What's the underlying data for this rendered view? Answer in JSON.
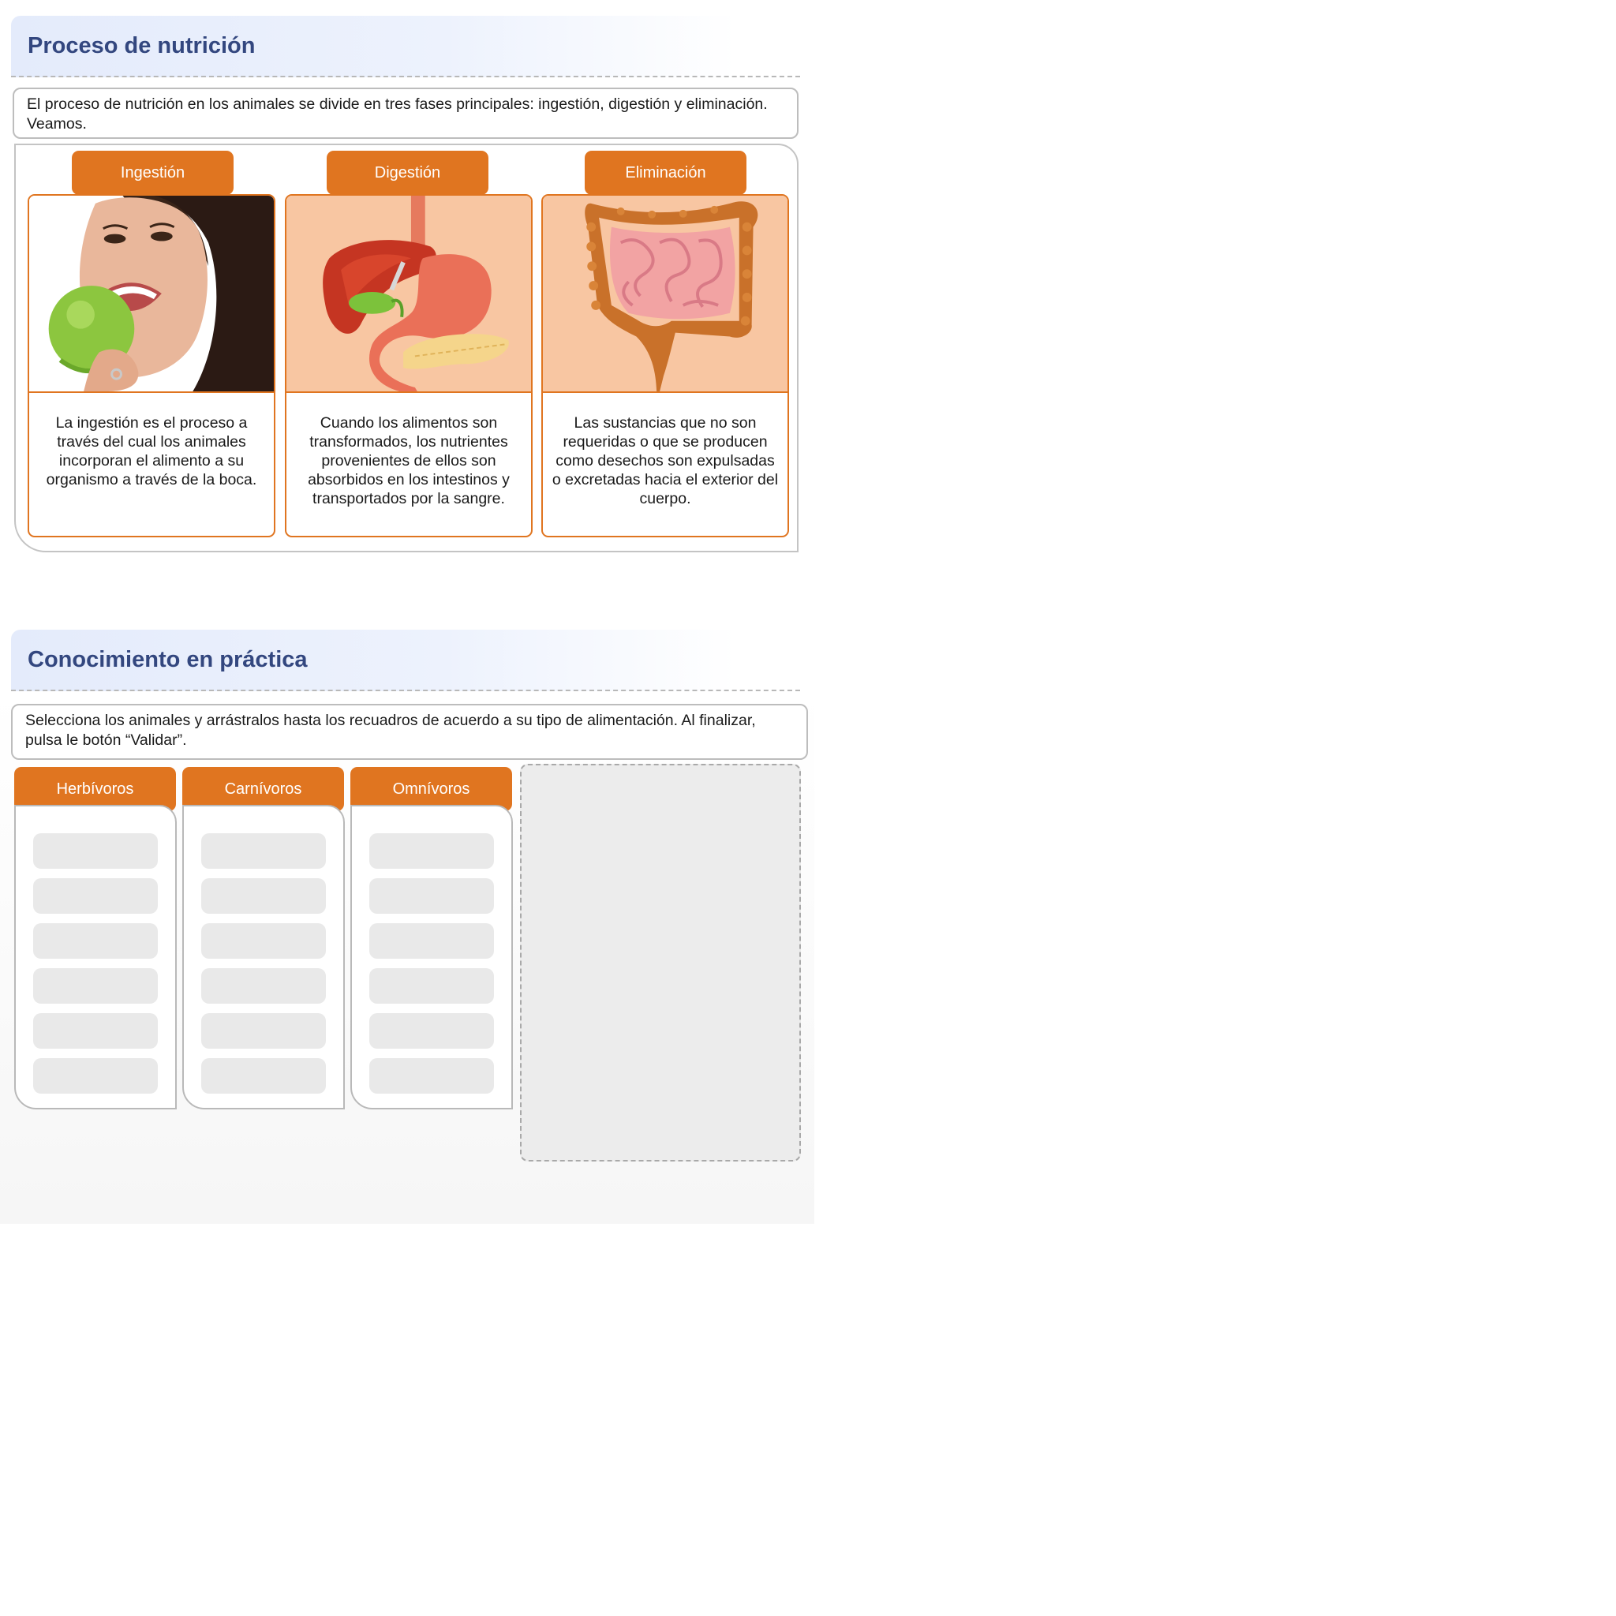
{
  "section1": {
    "title": "Proceso de nutrición",
    "intro": "El proceso de nutrición en los animales se divide en tres fases principales: ingestión, digestión y eliminación. Veamos.",
    "phases": [
      {
        "tab": "Ingestión",
        "image_icon": "person-eating-apple-image",
        "text": "La ingestión es el proceso a través del cual los animales incorporan el alimento a su organismo a través de la boca."
      },
      {
        "tab": "Digestión",
        "image_icon": "digestive-organs-image",
        "text": "Cuando los alimentos son transformados, los nutrientes provenientes de ellos son absorbidos en los intestinos y transportados por la sangre."
      },
      {
        "tab": "Eliminación",
        "image_icon": "intestines-image",
        "text": "Las sustancias que no son requeridas o que se producen como desechos son expulsadas o excretadas hacia el exterior del cuerpo."
      }
    ]
  },
  "section2": {
    "title": "Conocimiento en práctica",
    "instructions": "Selecciona los animales y arrástralos hasta los recuadros de acuerdo a su tipo de alimentación. Al finalizar, pulsa le botón “Validar”.",
    "categories": [
      {
        "label": "Herbívoros",
        "slots": 6
      },
      {
        "label": "Carnívoros",
        "slots": 6
      },
      {
        "label": "Omnívoros",
        "slots": 6
      }
    ]
  },
  "colors": {
    "accent_orange": "#e07520",
    "title_blue": "#33477f",
    "image_peach": "#f8c6a2"
  }
}
